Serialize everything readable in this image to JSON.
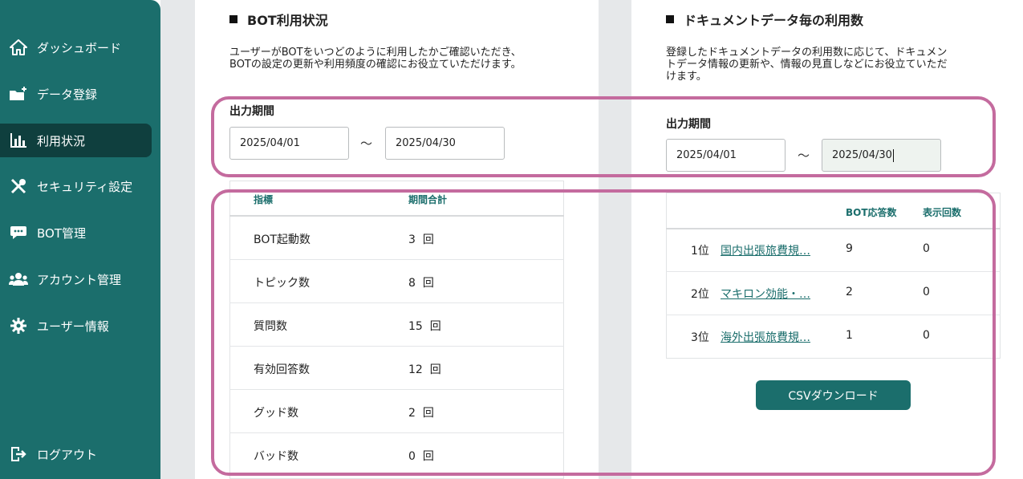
{
  "sidebar": {
    "items": [
      {
        "label": "ダッシュボード",
        "icon": "home-icon"
      },
      {
        "label": "データ登録",
        "icon": "folder-plus-icon"
      },
      {
        "label": "利用状況",
        "icon": "bar-chart-icon"
      },
      {
        "label": "セキュリティ設定",
        "icon": "tools-icon"
      },
      {
        "label": "BOT管理",
        "icon": "chat-bubble-icon"
      },
      {
        "label": "アカウント管理",
        "icon": "users-icon"
      },
      {
        "label": "ユーザー情報",
        "icon": "gear-icon"
      }
    ],
    "logout_label": "ログアウト"
  },
  "bot_usage": {
    "title": "BOT利用状況",
    "desc_line1": "ユーザーがBOTをいつどのように利用したかご確認いただき、",
    "desc_line2": "BOTの設定の更新や利用頻度の確認にお役立ていただけます。",
    "period_label": "出力期間",
    "date_from": "2025/04/01",
    "date_to": "2025/04/30",
    "tilde": "～",
    "headers": {
      "metric": "指標",
      "total": "期間合計"
    },
    "rows": [
      {
        "metric": "BOT起動数",
        "value": "3",
        "unit": "回"
      },
      {
        "metric": "トピック数",
        "value": "8",
        "unit": "回"
      },
      {
        "metric": "質問数",
        "value": "15",
        "unit": "回"
      },
      {
        "metric": "有効回答数",
        "value": "12",
        "unit": "回"
      },
      {
        "metric": "グッド数",
        "value": "2",
        "unit": "回"
      },
      {
        "metric": "バッド数",
        "value": "0",
        "unit": "回"
      }
    ]
  },
  "doc_usage": {
    "title": "ドキュメントデータ毎の利用数",
    "desc_line1": "登録したドキュメントデータの利用数に応じて、ドキュメン",
    "desc_line2": "トデータ情報の更新や、情報の見直しなどにお役立ていただ",
    "desc_line3": "けます。",
    "period_label": "出力期間",
    "date_from": "2025/04/01",
    "date_to": "2025/04/30",
    "tilde": "～",
    "headers": {
      "answers": "BOT応答数",
      "views": "表示回数"
    },
    "rows": [
      {
        "rank": "1位",
        "name": "国内出張旅費規…",
        "answers": "9",
        "views": "0"
      },
      {
        "rank": "2位",
        "name": "マキロン効能・…",
        "answers": "2",
        "views": "0"
      },
      {
        "rank": "3位",
        "name": "海外出張旅費規…",
        "answers": "1",
        "views": "0"
      }
    ],
    "csv_label": "CSVダウンロード"
  },
  "colors": {
    "brand": "#1b6e6c",
    "active": "#0f3f3e",
    "highlight": "#c46b9e"
  }
}
